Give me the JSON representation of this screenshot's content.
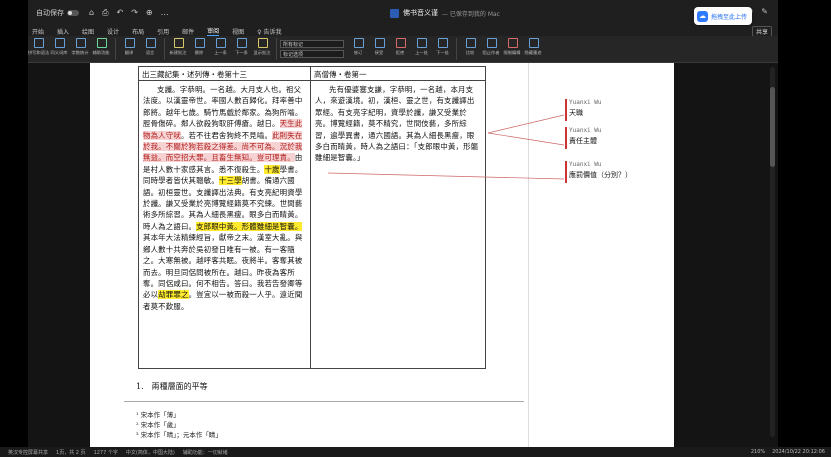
{
  "titlebar": {
    "autosave_label": "自动保存",
    "autosave_state": "关",
    "qat": [
      "⌂",
      "⎙",
      "↶",
      "↷",
      "⊕",
      "…"
    ],
    "doc_name": "佛书音义谨",
    "saved_status": "— 已保存到我的 Mac",
    "search_icon": "search-icon",
    "right_icons": [
      "☺",
      "⚙",
      "✎"
    ]
  },
  "upload": {
    "label": "拖拽至此上传"
  },
  "tabs": [
    "开始",
    "插入",
    "绘图",
    "设计",
    "布局",
    "引用",
    "邮件",
    "审阅",
    "视图",
    "♀ 告诉我"
  ],
  "active_tab": "审阅",
  "share_label": "共享",
  "ribbon": {
    "buttons": [
      {
        "label": "拼写和语法",
        "icon": "spellcheck-icon",
        "color": "blue"
      },
      {
        "label": "同义词库",
        "icon": "thesaurus-icon",
        "color": "blue"
      },
      {
        "label": "字数统计",
        "icon": "word-count-icon",
        "color": "blue"
      },
      {
        "label": "辅助功能",
        "icon": "accessibility-icon",
        "color": "green"
      },
      {
        "label": "翻译",
        "icon": "translate-icon",
        "color": "blue"
      },
      {
        "label": "语言",
        "icon": "language-icon",
        "color": "blue"
      },
      {
        "label": "新建批注",
        "icon": "new-comment-icon",
        "color": "yellow"
      },
      {
        "label": "删除",
        "icon": "delete-icon",
        "color": "blue"
      },
      {
        "label": "上一条",
        "icon": "prev-icon",
        "color": "blue"
      },
      {
        "label": "下一条",
        "icon": "next-icon",
        "color": "blue"
      },
      {
        "label": "显示批注",
        "icon": "show-comments-icon",
        "color": "yellow"
      },
      {
        "label": "修订",
        "icon": "track-changes-icon",
        "color": "blue"
      },
      {
        "label": "接受",
        "icon": "accept-icon",
        "color": "blue"
      },
      {
        "label": "拒绝",
        "icon": "reject-icon",
        "color": "red"
      },
      {
        "label": "上一处",
        "icon": "prev-change-icon",
        "color": "blue"
      },
      {
        "label": "下一处",
        "icon": "next-change-icon",
        "color": "blue"
      },
      {
        "label": "比较",
        "icon": "compare-icon",
        "color": "blue"
      },
      {
        "label": "阻止作者",
        "icon": "block-authors-icon",
        "color": "blue"
      },
      {
        "label": "限制编辑",
        "icon": "restrict-icon",
        "color": "red"
      },
      {
        "label": "隐藏墨迹",
        "icon": "hide-ink-icon",
        "color": "blue"
      }
    ],
    "markup_select": "所有标记",
    "markup_options": "标记选项"
  },
  "document": {
    "left_header": "出三藏記集・述列傳・卷第十三",
    "right_header": "高僧傳・卷第一",
    "left_body": [
      {
        "t": "支讖。字恭明。一名越。大月支人也。祖父法度。以漢靈帝世。率國人數百歸化。拜率善中郎將。越年七歲。騎竹馬戲於鄰家。為狗所嚙。脛骨傷碎。鄰人欲殺狗取肝傅瘡。越日。"
      },
      {
        "t": "天生此物為人守吠",
        "h": "p"
      },
      {
        "t": "。若不往君舍狗終不見嚙。"
      },
      {
        "t": "此則失在於我。不關於狗若殺之得差。尚不可為。況於我無益。而空招大罪。且畜生無知。豈可理責。",
        "h": "p"
      },
      {
        "t": "由是村人數十家感其言。悉不復殺生。"
      },
      {
        "t": "十歲",
        "h": "y"
      },
      {
        "t": "學書。同時學者皆伏其聰敏。"
      },
      {
        "t": "十三學",
        "h": "y"
      },
      {
        "t": "胡書。備通六國語。初桓靈世。支讖譯出法典。有支亮紀明資學於讖。謙又受業於亮博覽經籍莫不究練。世間藝術多所綜習。其為人細長黑瘦。眼多白而睛黃。時人為之語曰。"
      },
      {
        "t": "支郎眼中黃。形體雖細是智囊。",
        "h": "y"
      },
      {
        "t": "其本年大法精練經旨，獻帝之末。漢室大亂。與鄉人數十共奔於吳初發日唯有一被。有一客隨之。大寒無被。越呼客共眠。夜將半。客奪其被而去。明旦同侶問被所在。越曰。昨夜為客所奪。同侶咸曰。何不相告。答曰。我若告發卿等必以"
      },
      {
        "t": "劫罪罪之",
        "h": "y"
      },
      {
        "t": "。豈宜以一被而殺一人乎。遠近聞者莫不歎服。"
      }
    ],
    "right_body": "先有優婆塞支謙，字恭明，一名越，本月支人，來遊漢境。初，漢桓、靈之世，有支讖譯出眾經。有支亮字紀明，資學於讖，謙又受業於亮。博覽經籍，莫不精究，世間伎藝，多所綜習，遍學異書，通六國語。其為人細長黑瘦，眼多白而睛黃，時人為之語曰：「支郎眼中黃，形軀雖細是智囊。」",
    "list_item": "1.　兩種層面的平等",
    "footnotes": [
      "¹ 宋本作「薄」",
      "² 宋本作「歲」",
      "³ 宋本作「晴」；元本作「睛」"
    ]
  },
  "comments": [
    {
      "author": "Yuanxi Wu",
      "text": "天職"
    },
    {
      "author": "Yuanxi Wu",
      "text": "責任主體"
    },
    {
      "author": "Yuanxi Wu",
      "text": "應罰價值（分別？）"
    }
  ],
  "statusbar": {
    "items": [
      "英汉专控屏幕共享",
      "1页，共 2 页",
      "1277 个字",
      "中文(简体，中国大陆)",
      "辅助功能：一切就绪"
    ],
    "zoom": "210%",
    "datetime": "2024/10/22 20:12:06"
  },
  "colors": {
    "accent": "#4aa3ff",
    "highlight_yellow": "#ffea2e",
    "highlight_pink": "#f6d2d2",
    "comment_red": "#cc3333"
  }
}
